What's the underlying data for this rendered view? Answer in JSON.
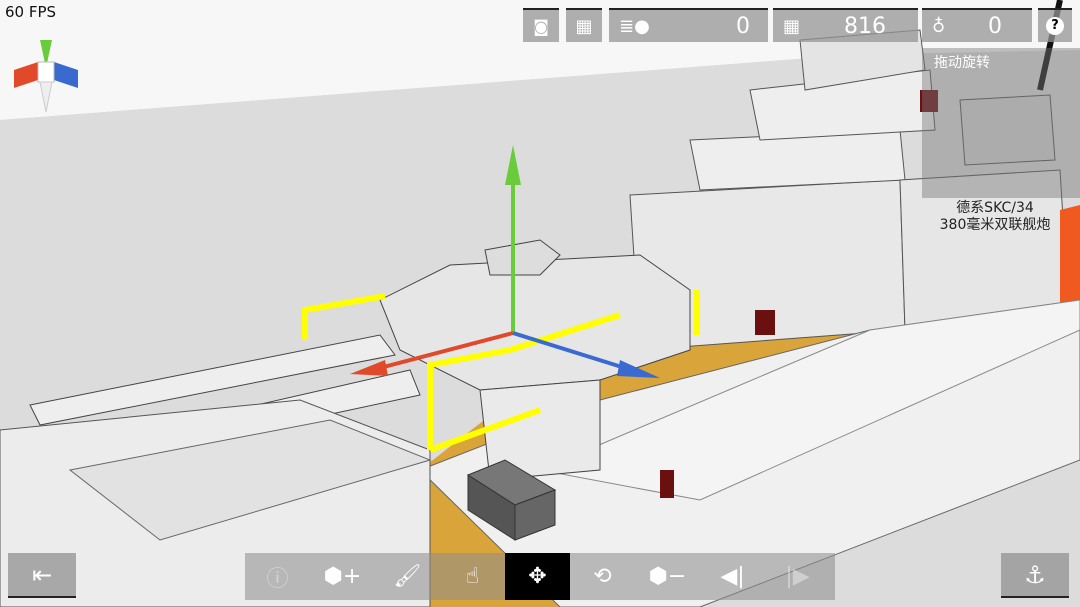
{
  "hud": {
    "fps": "60 FPS"
  },
  "topbar": {
    "camera_icon": "camera-icon",
    "grid_icon": "grid-icon",
    "coins": {
      "icon": "coins-icon",
      "value": "0"
    },
    "blocks": {
      "icon": "blocks-icon",
      "value": "816"
    },
    "medals": {
      "icon": "medal-icon",
      "value": "0"
    },
    "help_label": "?"
  },
  "hint": {
    "label": "拖动旋转"
  },
  "selected_part": {
    "line1": "德系SKC/34",
    "line2": "380毫米双联舰炮"
  },
  "toolbar": {
    "tools": [
      {
        "name": "info",
        "glyph": "ⓘ",
        "state": "disabled"
      },
      {
        "name": "add-block",
        "glyph": "⬢+",
        "state": "normal"
      },
      {
        "name": "paint-roller",
        "glyph": "🖌",
        "state": "normal"
      },
      {
        "name": "select-hand",
        "glyph": "☝",
        "state": "normal"
      },
      {
        "name": "move",
        "glyph": "✥",
        "state": "active"
      },
      {
        "name": "rotate",
        "glyph": "⟲",
        "state": "normal"
      },
      {
        "name": "remove-block",
        "glyph": "⬢−",
        "state": "normal"
      },
      {
        "name": "undo",
        "glyph": "◀|",
        "state": "normal"
      },
      {
        "name": "redo",
        "glyph": "|▶",
        "state": "disabled"
      }
    ]
  },
  "exit_glyph": "⇤",
  "anchor_glyph": "⚓",
  "colors": {
    "deck": "#d9a43a",
    "gizmo_x": "#e04a2a",
    "gizmo_y": "#6acc3a",
    "gizmo_z": "#3a6ad0",
    "scale_handles": "#ffff00"
  }
}
